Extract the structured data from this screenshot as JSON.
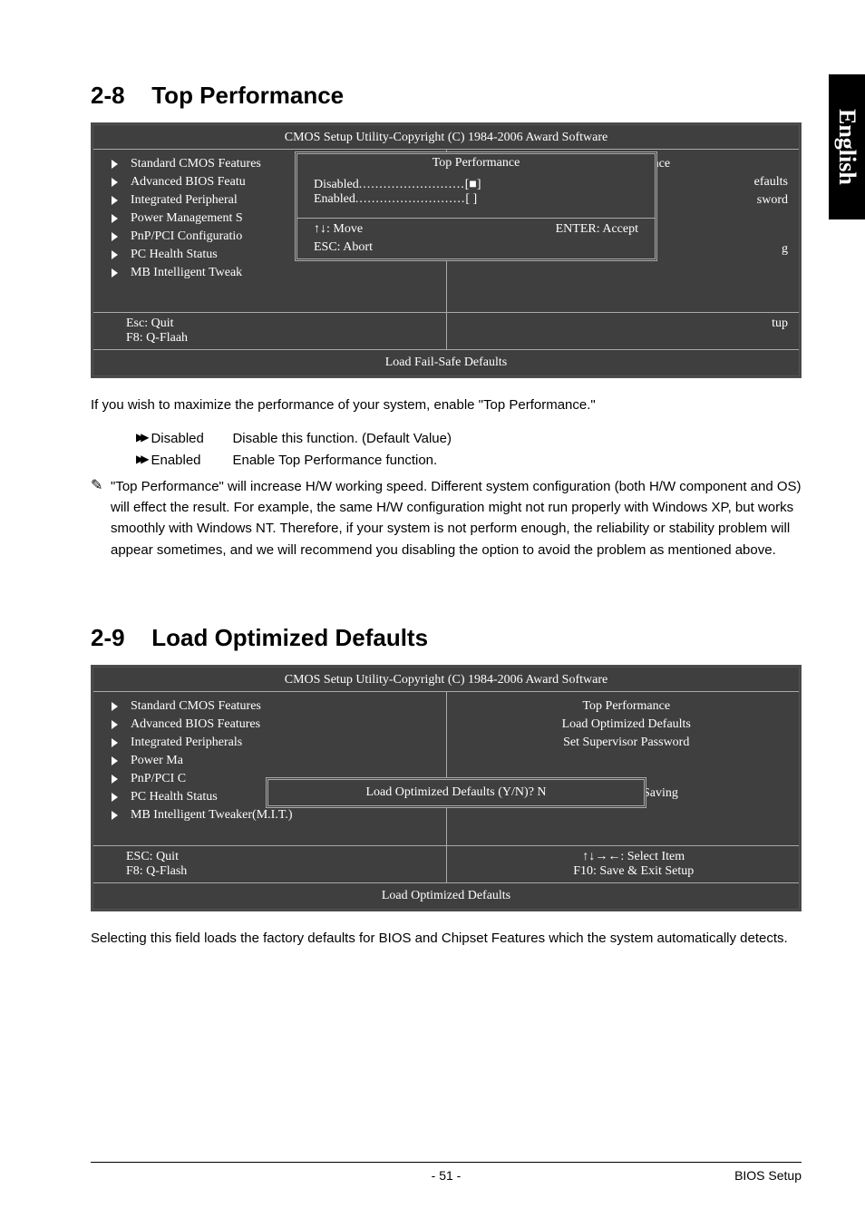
{
  "side_tab": "English",
  "section1": {
    "num": "2-8",
    "title": "Top Performance",
    "bios_title": "CMOS Setup Utility-Copyright (C) 1984-2006 Award Software",
    "left_items": [
      "Standard CMOS Features",
      "Advanced BIOS Featu",
      "Integrated Peripheral",
      "Power Management S",
      "PnP/PCI Configuratio",
      "PC Health Status",
      "MB Intelligent Tweak"
    ],
    "right_items": [
      "Top Performance",
      "efaults",
      "sword",
      "",
      "g"
    ],
    "ftr_left": [
      "Esc: Quit",
      "F8: Q-Flaah"
    ],
    "ftr_right": [
      "",
      "tup"
    ],
    "hint": "Load Fail-Safe Defaults",
    "popup": {
      "title": "Top Performance",
      "opt_disabled": "Disabled",
      "opt_enabled": "Enabled",
      "marker_on": "[■]",
      "marker_off": "[  ]",
      "help_move": "↑↓: Move",
      "help_accept": "ENTER: Accept",
      "help_abort": "ESC: Abort"
    },
    "intro": "If you wish to maximize the performance of your system, enable \"Top Performance.\"",
    "opts": [
      {
        "name": "Disabled",
        "desc": "Disable this function. (Default Value)"
      },
      {
        "name": "Enabled",
        "desc": "Enable Top Performance function."
      }
    ],
    "note": "\"Top Performance\" will increase H/W working speed. Different system configuration (both H/W component and OS) will effect the result. For example, the same H/W configuration might not run properly with Windows XP, but works smoothly with Windows NT. Therefore, if your system is not perform enough, the reliability or stability problem will appear sometimes, and we will recommend you disabling the option to avoid the problem as mentioned above."
  },
  "section2": {
    "num": "2-9",
    "title": "Load Optimized Defaults",
    "bios_title": "CMOS Setup Utility-Copyright (C) 1984-2006 Award Software",
    "left_items": [
      "Standard CMOS Features",
      "Advanced BIOS Features",
      "Integrated Peripherals",
      "Power Ma",
      "PnP/PCI C",
      "PC Health Status",
      "MB Intelligent Tweaker(M.I.T.)"
    ],
    "right_items": [
      "Top Performance",
      "Load Optimized Defaults",
      "Set Supervisor Password",
      "",
      "",
      "Exit Without Saving",
      ""
    ],
    "ftr_left": [
      "ESC: Quit",
      "F8: Q-Flash"
    ],
    "ftr_right": [
      "↑↓→←: Select Item",
      "F10: Save & Exit Setup"
    ],
    "hint": "Load Optimized Defaults",
    "popup_text": "Load Optimized Defaults (Y/N)? N",
    "desc": "Selecting this field loads the factory defaults for BIOS and Chipset Features which the system automatically detects."
  },
  "footer": {
    "page": "- 51 -",
    "right": "BIOS Setup"
  }
}
